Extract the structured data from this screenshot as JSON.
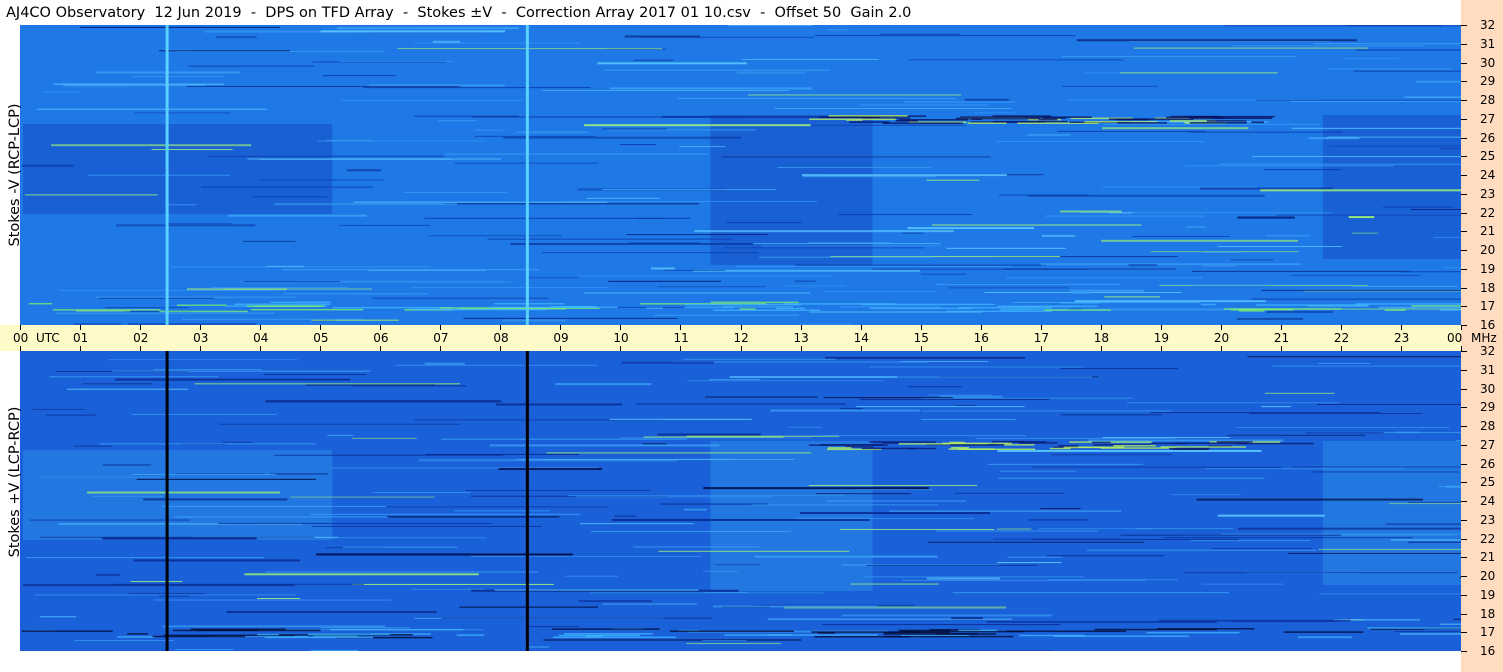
{
  "title": "AJ4CO Observatory  12 Jun 2019  -  DPS on TFD Array  -  Stokes ±V  -  Correction Array 2017 01 10.csv  -  Offset 50  Gain 2.0",
  "chart_data": {
    "type": "heatmap",
    "x_unit_label": "UTC",
    "y_unit_label": "MHz",
    "x_ticks": [
      "00",
      "01",
      "02",
      "03",
      "04",
      "05",
      "06",
      "07",
      "08",
      "09",
      "10",
      "11",
      "12",
      "13",
      "14",
      "15",
      "16",
      "17",
      "18",
      "19",
      "20",
      "21",
      "22",
      "23",
      "00"
    ],
    "y_ticks": [
      "32",
      "31",
      "30",
      "29",
      "28",
      "27",
      "26",
      "25",
      "24",
      "23",
      "22",
      "21",
      "20",
      "19",
      "18",
      "17",
      "16"
    ],
    "xlim_hours": [
      0,
      24
    ],
    "ylim_mhz": [
      16,
      32
    ],
    "panels": [
      {
        "ylabel": "Stokes -V (RCP-LCP)",
        "base_color": "#1e78e6",
        "dark_color": "#1650c8",
        "vertical_lines_hours": [
          2.45,
          8.45
        ],
        "vertical_line_color": "#5ad2ff"
      },
      {
        "ylabel": "Stokes +V (LCP-RCP)",
        "base_color": "#1a60d8",
        "dark_color": "#1244b8",
        "vertical_lines_hours": [
          2.45,
          8.45
        ],
        "vertical_line_color": "#000000"
      }
    ]
  }
}
